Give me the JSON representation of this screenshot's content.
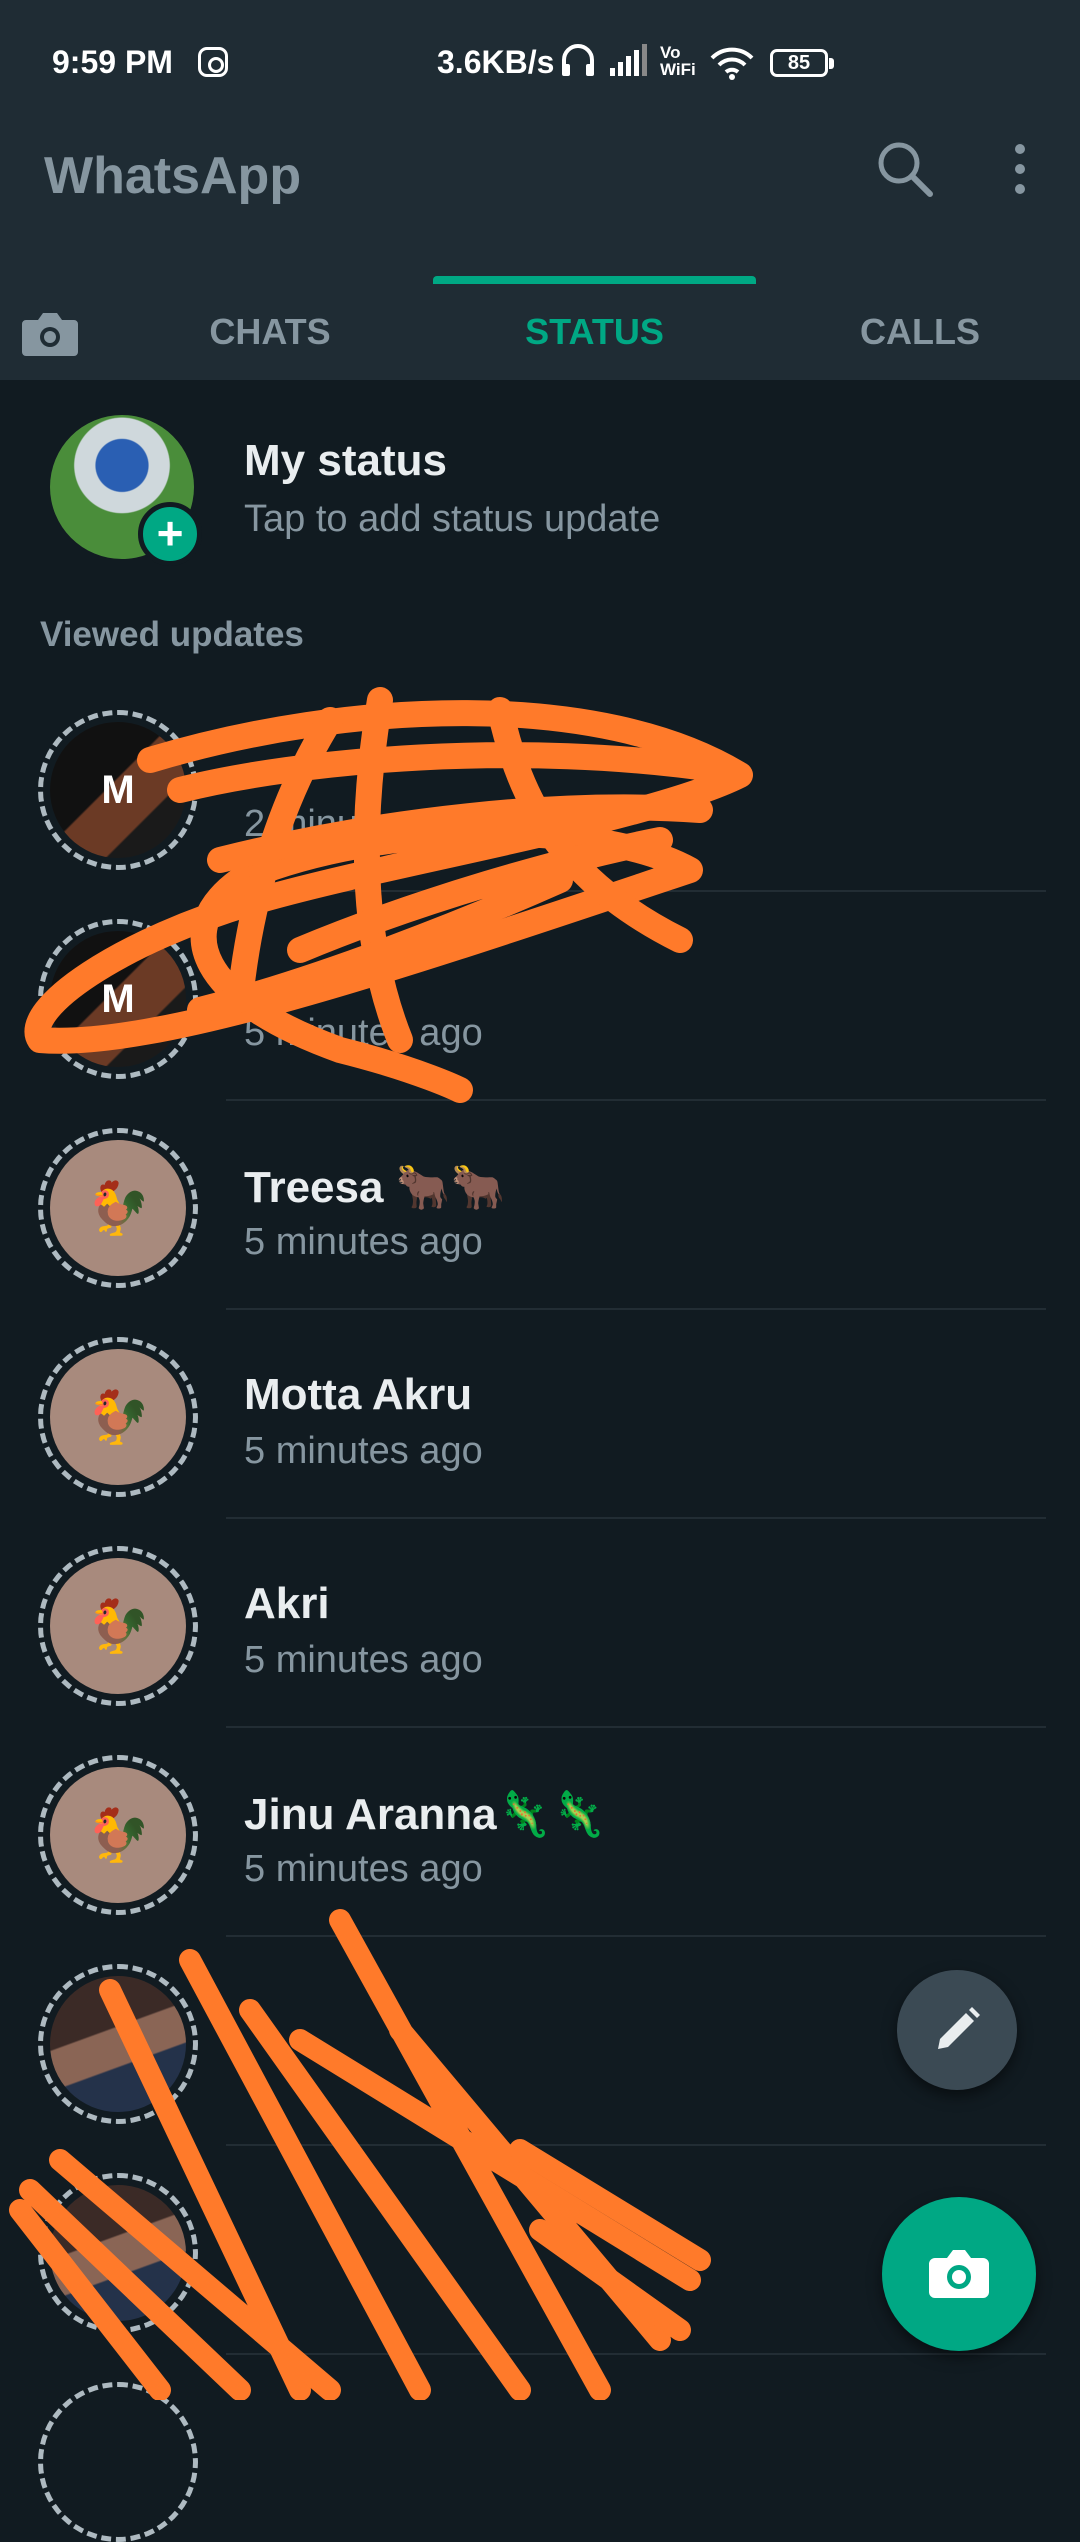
{
  "status_bar": {
    "time": "9:59 PM",
    "network_speed": "3.6KB/s",
    "vo_wifi_top": "Vo",
    "vo_wifi_bottom": "WiFi",
    "battery": "85",
    "icons": [
      "instagram-icon",
      "headphones-icon",
      "signal-icon",
      "wifi-icon",
      "battery-icon"
    ]
  },
  "app_bar": {
    "title": "WhatsApp",
    "icons": [
      "search-icon",
      "more-vert-icon"
    ]
  },
  "tabs": {
    "camera_icon": "camera-icon",
    "items": [
      {
        "label": "CHATS",
        "active": false
      },
      {
        "label": "STATUS",
        "active": true
      },
      {
        "label": "CALLS",
        "active": false
      }
    ]
  },
  "my_status": {
    "title": "My status",
    "subtitle": "Tap to add status update",
    "badge": "+"
  },
  "section_label": "Viewed updates",
  "status_list": [
    {
      "name": "",
      "time": "2 minutes ago",
      "redacted": true,
      "avatar": "poster",
      "avatar_text": "M"
    },
    {
      "name": "",
      "time": "5 minutes ago",
      "redacted": true,
      "avatar": "poster",
      "avatar_text": "M"
    },
    {
      "name": "Treesa 🐂🐂",
      "time": "5 minutes ago",
      "avatar": "rooster",
      "avatar_text": "🐓"
    },
    {
      "name": "Motta Akru",
      "time": "5 minutes ago",
      "avatar": "rooster",
      "avatar_text": "🐓"
    },
    {
      "name": "Akri",
      "time": "5 minutes ago",
      "avatar": "rooster",
      "avatar_text": "🐓"
    },
    {
      "name": "Jinu Aranna🦎🦎",
      "time": "5 minutes ago",
      "avatar": "rooster",
      "avatar_text": "🐓"
    },
    {
      "name": "",
      "time": "",
      "redacted": true,
      "avatar": "photo",
      "avatar_text": ""
    },
    {
      "name": "",
      "time": "",
      "redacted": true,
      "avatar": "photo",
      "avatar_text": ""
    }
  ],
  "fabs": {
    "edit_icon": "pencil-icon",
    "camera_icon": "camera-icon"
  },
  "colors": {
    "background": "#111b21",
    "app_bar": "#1f2c34",
    "accent": "#00a884",
    "secondary_text": "#8696a0",
    "scribble": "#ff7a2a"
  }
}
